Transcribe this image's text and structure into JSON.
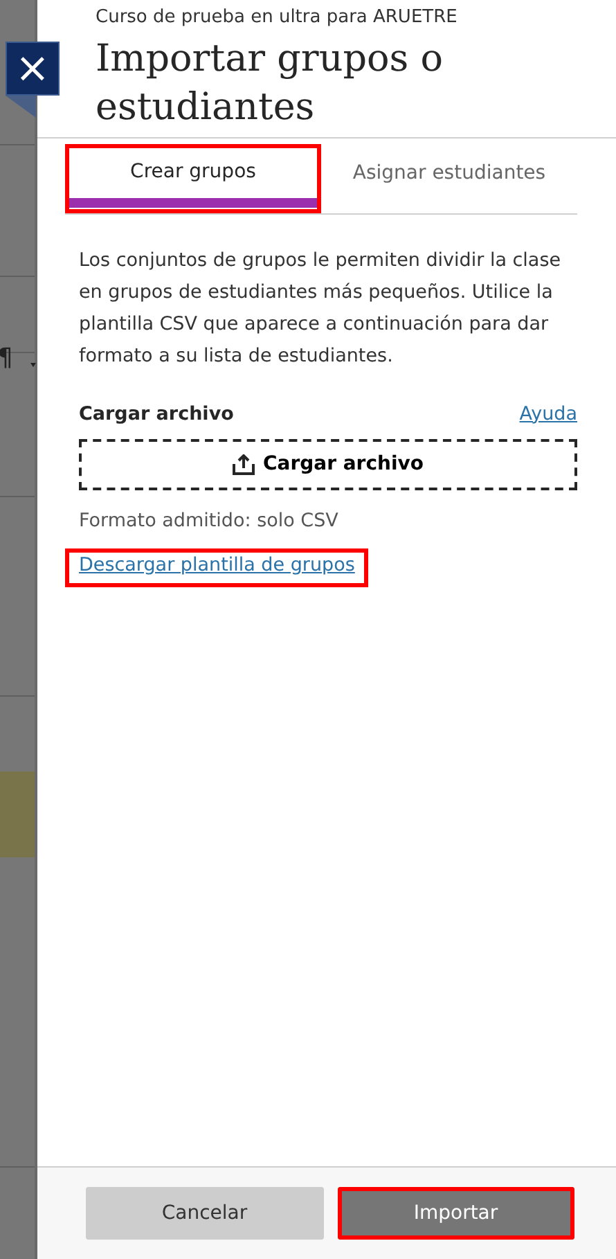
{
  "background": {
    "symbol": "¶"
  },
  "close_button": {
    "label": "×"
  },
  "panel": {
    "subtitle": "Curso de prueba en ultra para ARUETRE",
    "title": "Importar grupos o estudiantes"
  },
  "tabs": [
    {
      "label": "Crear grupos",
      "selected": true,
      "highlighted": true
    },
    {
      "label": "Asignar estudiantes",
      "selected": false,
      "highlighted": false
    }
  ],
  "description": "Los conjuntos de grupos le permiten dividir la clase en grupos de estudiantes más pequeños. Utilice la plantilla CSV que aparece a continuación para dar formato a su lista de estudiantes.",
  "upload": {
    "label": "Cargar archivo",
    "help_link": "Ayuda",
    "button": "Cargar archivo",
    "hint": "Formato admitido: solo CSV"
  },
  "template_link": {
    "label": "Descargar plantilla de grupos",
    "highlighted": true
  },
  "footer_buttons": [
    {
      "label": "Cancelar",
      "kind": "secondary",
      "highlighted": false
    },
    {
      "label": "Importar",
      "kind": "primary",
      "highlighted": true
    }
  ]
}
